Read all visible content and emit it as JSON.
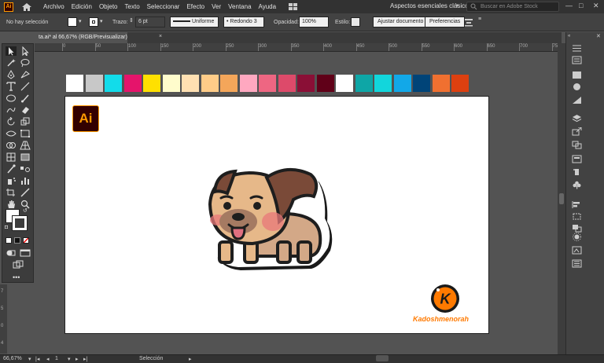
{
  "menubar": {
    "app_logo": "Ai",
    "items": [
      "Archivo",
      "Edición",
      "Objeto",
      "Texto",
      "Seleccionar",
      "Efecto",
      "Ver",
      "Ventana",
      "Ayuda"
    ],
    "workspace": "Aspectos esenciales clásicos",
    "search_placeholder": "Buscar en Adobe Stock"
  },
  "controlbar": {
    "selection_status": "No hay selección",
    "stroke_label": "Trazo:",
    "stroke_weight": "6 pt",
    "profile": "Uniforme",
    "brush": "Redondo 3 ...",
    "opacity_label": "Opacidad:",
    "opacity_value": "100%",
    "style_label": "Estilo:",
    "adjust_button": "Ajustar documento",
    "prefs_button": "Preferencias"
  },
  "document": {
    "tab_title": "ta.ai* al 66,67% (RGB/Previsualizar)",
    "close_glyph": "×"
  },
  "rulers": {
    "top_ticks": [
      "0",
      "50",
      "100",
      "150",
      "200",
      "250",
      "300",
      "350",
      "400",
      "450",
      "500",
      "550",
      "600",
      "650",
      "700",
      "750"
    ],
    "left_ticks": [
      "7",
      "5",
      "0",
      "4"
    ]
  },
  "canvas": {
    "ai_logo": "Ai",
    "brand_initial": "K",
    "brand_name": "Kadoshmenorah",
    "palette": [
      "#ffffff",
      "#c8c8c8",
      "#12dcea",
      "#e5146b",
      "#ffe000",
      "#fffccc",
      "#ffe0b2",
      "#ffcc88",
      "#f4a65a",
      "#ffa8c0",
      "#ee6682",
      "#dd4a6a",
      "#8a0f36",
      "#600018",
      "#ffffff",
      "#0ea6a6",
      "#12d6dc",
      "#12a8e8",
      "#004478",
      "#f07030",
      "#dd4010"
    ]
  },
  "statusbar": {
    "zoom": "66,67%",
    "artboard": "1",
    "tool": "Selección"
  },
  "colors": {
    "ai_orange": "#ff9a00",
    "ai_bg": "#330000",
    "pug_fur": "#e6b889",
    "pug_ear": "#7a4a38",
    "pug_cheek": "#e8787a",
    "brand_orange": "#ff7a00"
  }
}
